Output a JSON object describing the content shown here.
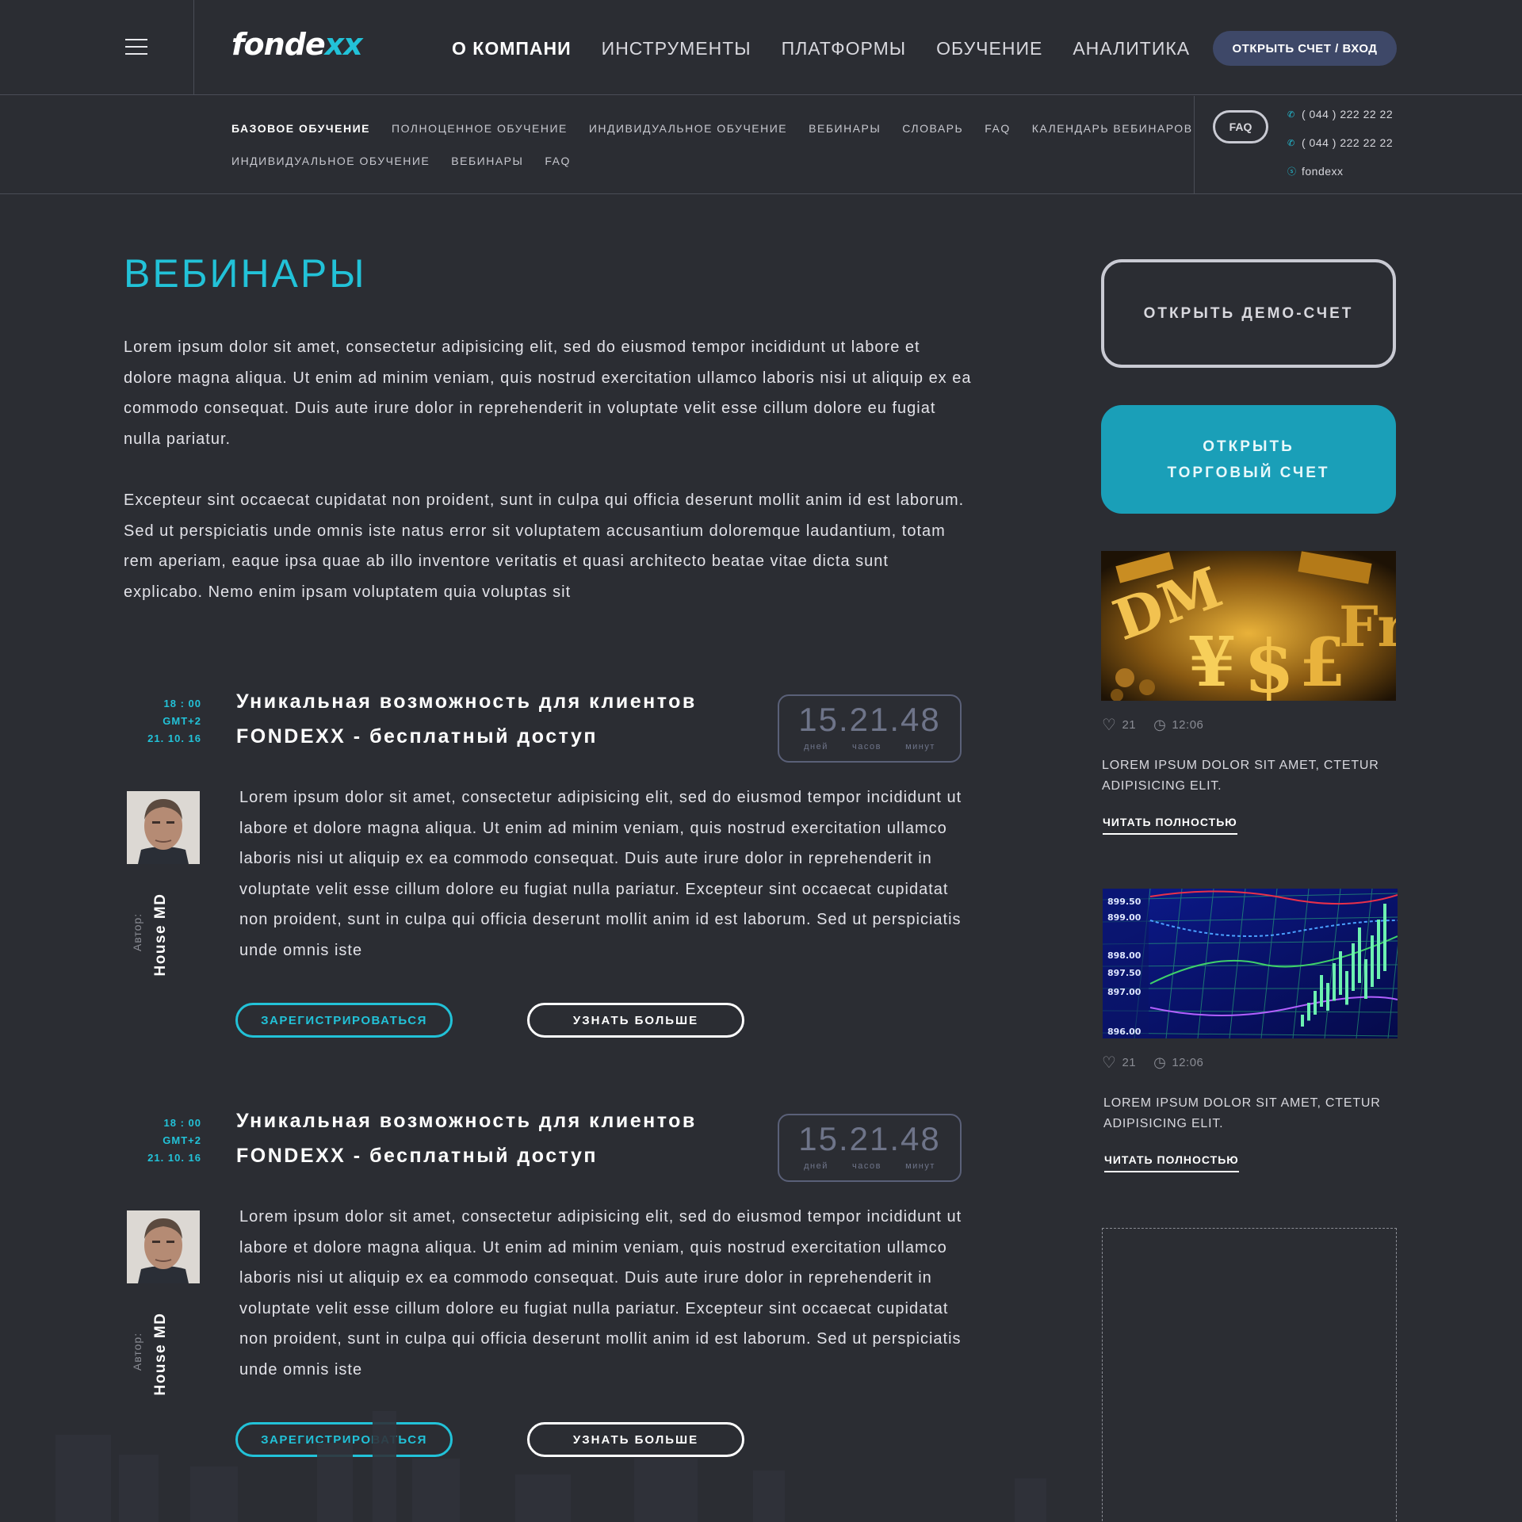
{
  "header": {
    "logo_main": "fonde",
    "logo_accent": "xx",
    "nav": [
      "О КОМПАНИ",
      "ИНСТРУМЕНТЫ",
      "ПЛАТФОРМЫ",
      "ОБУЧЕНИЕ",
      "АНАЛИТИКА"
    ],
    "login_label": "ОТКРЫТЬ СЧЕТ / ВХОД"
  },
  "subnav": {
    "row1": [
      "БАЗОВОЕ ОБУЧЕНИЕ",
      "ПОЛНОЦЕННОЕ ОБУЧЕНИЕ",
      "ИНДИВИДУАЛЬНОЕ ОБУЧЕНИЕ",
      "ВЕБИНАРЫ",
      "СЛОВАРЬ",
      "FAQ",
      "КАЛЕНДАРЬ ВЕБИНАРОВ"
    ],
    "row2": [
      "ИНДИВИДУАЛЬНОЕ ОБУЧЕНИЕ",
      "ВЕБИНАРЫ",
      "FAQ"
    ],
    "faq_label": "FAQ",
    "phone1": "( 044 ) 222 22 22",
    "phone2": "( 044 ) 222 22 22",
    "skype": "fondexx"
  },
  "page": {
    "title": "ВЕБИНАРЫ",
    "intro1": "Lorem ipsum dolor sit amet, consectetur adipisicing elit, sed do eiusmod tempor incididunt ut labore et dolore magna aliqua. Ut enim ad minim veniam, quis nostrud exercitation ullamco laboris nisi ut aliquip ex ea commodo consequat. Duis aute irure dolor in reprehenderit in voluptate velit esse cillum dolore eu fugiat nulla pariatur.",
    "intro2": "Excepteur sint occaecat cupidatat non proident, sunt in culpa qui officia deserunt mollit anim id est laborum. Sed ut perspiciatis unde omnis iste natus error sit voluptatem accusantium doloremque laudantium, totam rem aperiam, eaque ipsa quae ab illo inventore veritatis et quasi architecto beatae vitae dicta sunt explicabo. Nemo enim ipsam voluptatem quia voluptas sit"
  },
  "webinars": [
    {
      "time": "18 : 00",
      "tz": "GMT+2",
      "date": "21. 10. 16",
      "title": "Уникальная возможность для клиентов FONDEXX - бесплатный доступ",
      "timer": "15.21.48",
      "timer_labels": [
        "дней",
        "часов",
        "минут"
      ],
      "author_label": "Автор:",
      "author": "House MD",
      "body": "Lorem ipsum dolor sit amet, consectetur adipisicing elit, sed do eiusmod tempor incididunt ut labore et dolore magna aliqua. Ut enim ad minim veniam, quis nostrud exercitation ullamco laboris nisi ut aliquip ex ea commodo consequat. Duis aute irure dolor in reprehenderit in voluptate velit esse cillum dolore eu fugiat nulla pariatur. Excepteur sint occaecat cupidatat non proident, sunt in culpa qui officia deserunt mollit anim id est laborum. Sed ut perspiciatis unde omnis iste",
      "register_label": "ЗАРЕГИСТРИРОВАТЬСЯ",
      "more_label": "УЗНАТЬ  БОЛЬШЕ"
    },
    {
      "time": "18 : 00",
      "tz": "GMT+2",
      "date": "21. 10. 16",
      "title": "Уникальная возможность для клиентов FONDEXX - бесплатный доступ",
      "timer": "15.21.48",
      "timer_labels": [
        "дней",
        "часов",
        "минут"
      ],
      "author_label": "Автор:",
      "author": "House MD",
      "body": "Lorem ipsum dolor sit amet, consectetur adipisicing elit, sed do eiusmod tempor incididunt ut labore et dolore magna aliqua. Ut enim ad minim veniam, quis nostrud exercitation ullamco laboris nisi ut aliquip ex ea commodo consequat. Duis aute irure dolor in reprehenderit in voluptate velit esse cillum dolore eu fugiat nulla pariatur. Excepteur sint occaecat cupidatat non proident, sunt in culpa qui officia deserunt mollit anim id est laborum. Sed ut perspiciatis unde omnis iste",
      "register_label": "ЗАРЕГИСТРИРОВАТЬСЯ",
      "more_label": "УЗНАТЬ  БОЛЬШЕ"
    }
  ],
  "sidebar": {
    "demo_label": "ОТКРЫТЬ ДЕМО-СЧЕТ",
    "trade_line1": "ОТКРЫТЬ",
    "trade_line2": "ТОРГОВЫЙ СЧЕТ",
    "cards": [
      {
        "likes": "21",
        "time": "12:06",
        "text": "LOREM IPSUM DOLOR SIT AMET, CTETUR ADIPISICING ELIT.",
        "link": "ЧИТАТЬ ПОЛНОСТЬЮ"
      },
      {
        "likes": "21",
        "time": "12:06",
        "text": "LOREM IPSUM DOLOR SIT AMET, CTETUR ADIPISICING ELIT.",
        "link": "ЧИТАТЬ ПОЛНОСТЬЮ"
      }
    ],
    "chart_ticks": [
      "899.50",
      "899.00",
      "898.00",
      "897.50",
      "897.00",
      "896.00"
    ]
  },
  "colors": {
    "accent": "#22c2d8",
    "background": "#2b2d33",
    "trade_button": "#1a9fb8",
    "login_button": "#3e4868"
  }
}
